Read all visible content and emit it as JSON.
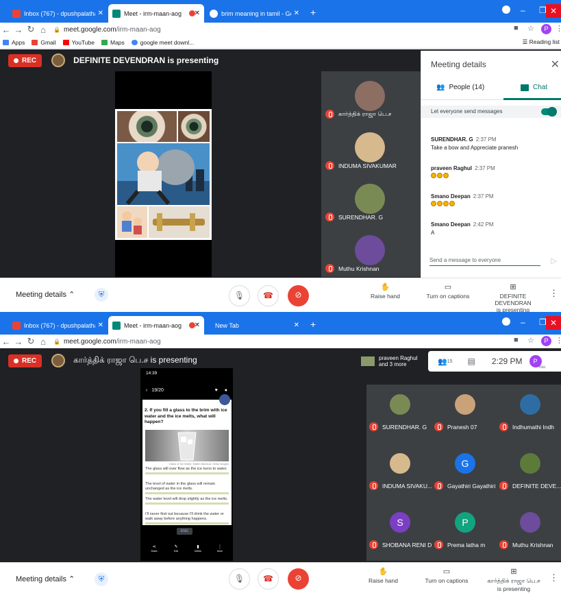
{
  "panes": [
    {
      "tabs": [
        {
          "title": "Inbox (767) - dpushpalatha@che",
          "favicon": "#ea4335"
        },
        {
          "title": "Meet - irm-maan-aog",
          "favicon": "#00897b"
        },
        {
          "title": "",
          "favicon": "#ea4335"
        },
        {
          "title": "brim meaning in tamil - Google",
          "favicon": "#4285f4"
        }
      ],
      "url_host": "meet.google.com",
      "url_path": "/irm-maan-aog"
    },
    {
      "tabs": [
        {
          "title": "Inbox (767) - dpushpalatha@che",
          "favicon": "#ea4335"
        },
        {
          "title": "Meet - irm-maan-aog",
          "favicon": "#00897b"
        },
        {
          "title": "",
          "favicon": "#ea4335"
        },
        {
          "title": "New Tab",
          "favicon": ""
        }
      ],
      "url_host": "meet.google.com",
      "url_path": "/irm-maan-aog"
    }
  ],
  "bookmarks": [
    {
      "label": "Apps",
      "color": "#4285f4"
    },
    {
      "label": "Gmail",
      "color": "#ea4335"
    },
    {
      "label": "YouTube",
      "color": "#ff0000"
    },
    {
      "label": "Maps",
      "color": "#34a853"
    },
    {
      "label": "google meet downl...",
      "color": "#4285f4"
    }
  ],
  "reading_list": "Reading list",
  "profile_letter": "P",
  "rec_label": "REC",
  "meeting1": {
    "presenting": "DEFINITE DEVENDRAN is presenting",
    "participants": [
      {
        "name": "கார்த்திக் ராஜா பெ.ச",
        "color": "#8d6e63"
      },
      {
        "name": "INDUMA SIVAKUMAR",
        "color": "#d7b98e"
      },
      {
        "name": "SURENDHAR. G",
        "color": "#7a8a55"
      },
      {
        "name": "Muthu Krishnan",
        "color": "#6d4c9b"
      }
    ],
    "details": {
      "title": "Meeting details",
      "people_tab": "People (14)",
      "chat_tab": "Chat",
      "toggle_label": "Let everyone send messages",
      "messages": [
        {
          "author": "SURENDHAR. G",
          "time": "2:37 PM",
          "text": "Take a bow and Appreciate pranesh",
          "emojis": 0
        },
        {
          "author": "praveen Raghul",
          "time": "2:37 PM",
          "text": "",
          "emojis": 3
        },
        {
          "author": "Smano Deepan",
          "time": "2:37 PM",
          "text": "",
          "emojis": 4
        },
        {
          "author": "Smano Deepan",
          "time": "2:42 PM",
          "text": "A",
          "emojis": 0
        }
      ],
      "input_placeholder": "Send a message to everyone"
    },
    "controls": {
      "meeting_details": "Meeting details",
      "raise_hand": "Raise hand",
      "captions": "Turn on captions",
      "presenter_line1": "DEFINITE DEVENDRAN",
      "presenter_line2": "is presenting"
    }
  },
  "meeting2": {
    "presenting": "கார்த்திக் ராஜா பெ.ச is presenting",
    "praveen_line1": "praveen Raghul",
    "praveen_line2": "and 3 more",
    "people_count": "15",
    "clock": "2:29 PM",
    "you_label": "You",
    "phone": {
      "status": "14:39",
      "counter": "19/20",
      "question": "2. If you fill a glass to the brim with ice water and the ice melts, what will happen?",
      "caption": "Glass of Ice Water. Martin Barraud, Getty Images",
      "options": [
        "The glass will over flow as the ice turns to water.",
        "The level of water in the glass will remain unchanged as the ice melts.",
        "The water level will drop slightly as the ice melts.",
        "I'll never find out because I'll drink the water or walk away before anything happens."
      ],
      "btn": "ENG",
      "bottom": [
        "Share",
        "Edit",
        "Delete",
        "More"
      ]
    },
    "grid": [
      {
        "name": "SURENDHAR. G",
        "letter": "",
        "color": "#7a8a55"
      },
      {
        "name": "Pranesh 07",
        "letter": "",
        "color": "#c9a27a"
      },
      {
        "name": "Indhumathi Indh",
        "letter": "",
        "color": "#2e6da4"
      },
      {
        "name": "INDUMA SIVAKU...",
        "letter": "",
        "color": "#d7b98e"
      },
      {
        "name": "Gayathiri Gayathiri",
        "letter": "G",
        "color": "#1a73e8"
      },
      {
        "name": "DEFINITE DEVE...",
        "letter": "",
        "color": "#5d7a3a"
      },
      {
        "name": "SHOBANA RENI D",
        "letter": "S",
        "color": "#7b3fc4"
      },
      {
        "name": "Prema latha m",
        "letter": "P",
        "color": "#12a37f"
      },
      {
        "name": "Muthu Krishnan",
        "letter": "",
        "color": "#6d4c9b"
      }
    ],
    "controls": {
      "meeting_details": "Meeting details",
      "raise_hand": "Raise hand",
      "captions": "Turn on captions",
      "presenter_line1": "கார்த்திக் ராஜா பெ.ச",
      "presenter_line2": "is presenting"
    }
  }
}
